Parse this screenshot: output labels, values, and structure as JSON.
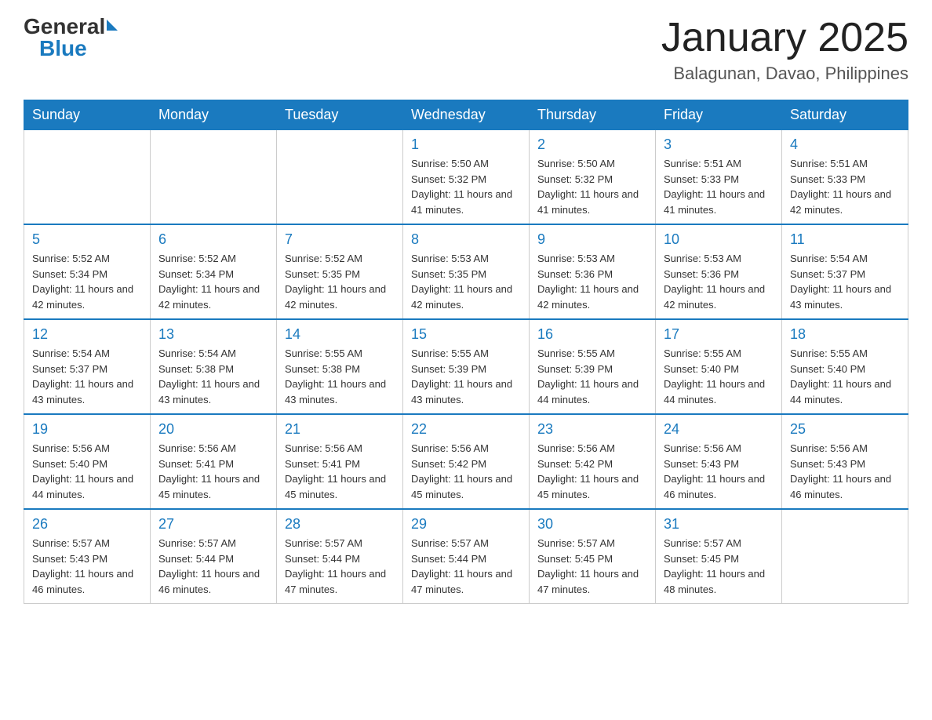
{
  "header": {
    "logo_general": "General",
    "logo_blue": "Blue",
    "month_title": "January 2025",
    "location": "Balagunan, Davao, Philippines"
  },
  "weekdays": [
    "Sunday",
    "Monday",
    "Tuesday",
    "Wednesday",
    "Thursday",
    "Friday",
    "Saturday"
  ],
  "weeks": [
    [
      {
        "day": "",
        "sunrise": "",
        "sunset": "",
        "daylight": ""
      },
      {
        "day": "",
        "sunrise": "",
        "sunset": "",
        "daylight": ""
      },
      {
        "day": "",
        "sunrise": "",
        "sunset": "",
        "daylight": ""
      },
      {
        "day": "1",
        "sunrise": "5:50 AM",
        "sunset": "5:32 PM",
        "daylight": "11 hours and 41 minutes."
      },
      {
        "day": "2",
        "sunrise": "5:50 AM",
        "sunset": "5:32 PM",
        "daylight": "11 hours and 41 minutes."
      },
      {
        "day": "3",
        "sunrise": "5:51 AM",
        "sunset": "5:33 PM",
        "daylight": "11 hours and 41 minutes."
      },
      {
        "day": "4",
        "sunrise": "5:51 AM",
        "sunset": "5:33 PM",
        "daylight": "11 hours and 42 minutes."
      }
    ],
    [
      {
        "day": "5",
        "sunrise": "5:52 AM",
        "sunset": "5:34 PM",
        "daylight": "11 hours and 42 minutes."
      },
      {
        "day": "6",
        "sunrise": "5:52 AM",
        "sunset": "5:34 PM",
        "daylight": "11 hours and 42 minutes."
      },
      {
        "day": "7",
        "sunrise": "5:52 AM",
        "sunset": "5:35 PM",
        "daylight": "11 hours and 42 minutes."
      },
      {
        "day": "8",
        "sunrise": "5:53 AM",
        "sunset": "5:35 PM",
        "daylight": "11 hours and 42 minutes."
      },
      {
        "day": "9",
        "sunrise": "5:53 AM",
        "sunset": "5:36 PM",
        "daylight": "11 hours and 42 minutes."
      },
      {
        "day": "10",
        "sunrise": "5:53 AM",
        "sunset": "5:36 PM",
        "daylight": "11 hours and 42 minutes."
      },
      {
        "day": "11",
        "sunrise": "5:54 AM",
        "sunset": "5:37 PM",
        "daylight": "11 hours and 43 minutes."
      }
    ],
    [
      {
        "day": "12",
        "sunrise": "5:54 AM",
        "sunset": "5:37 PM",
        "daylight": "11 hours and 43 minutes."
      },
      {
        "day": "13",
        "sunrise": "5:54 AM",
        "sunset": "5:38 PM",
        "daylight": "11 hours and 43 minutes."
      },
      {
        "day": "14",
        "sunrise": "5:55 AM",
        "sunset": "5:38 PM",
        "daylight": "11 hours and 43 minutes."
      },
      {
        "day": "15",
        "sunrise": "5:55 AM",
        "sunset": "5:39 PM",
        "daylight": "11 hours and 43 minutes."
      },
      {
        "day": "16",
        "sunrise": "5:55 AM",
        "sunset": "5:39 PM",
        "daylight": "11 hours and 44 minutes."
      },
      {
        "day": "17",
        "sunrise": "5:55 AM",
        "sunset": "5:40 PM",
        "daylight": "11 hours and 44 minutes."
      },
      {
        "day": "18",
        "sunrise": "5:55 AM",
        "sunset": "5:40 PM",
        "daylight": "11 hours and 44 minutes."
      }
    ],
    [
      {
        "day": "19",
        "sunrise": "5:56 AM",
        "sunset": "5:40 PM",
        "daylight": "11 hours and 44 minutes."
      },
      {
        "day": "20",
        "sunrise": "5:56 AM",
        "sunset": "5:41 PM",
        "daylight": "11 hours and 45 minutes."
      },
      {
        "day": "21",
        "sunrise": "5:56 AM",
        "sunset": "5:41 PM",
        "daylight": "11 hours and 45 minutes."
      },
      {
        "day": "22",
        "sunrise": "5:56 AM",
        "sunset": "5:42 PM",
        "daylight": "11 hours and 45 minutes."
      },
      {
        "day": "23",
        "sunrise": "5:56 AM",
        "sunset": "5:42 PM",
        "daylight": "11 hours and 45 minutes."
      },
      {
        "day": "24",
        "sunrise": "5:56 AM",
        "sunset": "5:43 PM",
        "daylight": "11 hours and 46 minutes."
      },
      {
        "day": "25",
        "sunrise": "5:56 AM",
        "sunset": "5:43 PM",
        "daylight": "11 hours and 46 minutes."
      }
    ],
    [
      {
        "day": "26",
        "sunrise": "5:57 AM",
        "sunset": "5:43 PM",
        "daylight": "11 hours and 46 minutes."
      },
      {
        "day": "27",
        "sunrise": "5:57 AM",
        "sunset": "5:44 PM",
        "daylight": "11 hours and 46 minutes."
      },
      {
        "day": "28",
        "sunrise": "5:57 AM",
        "sunset": "5:44 PM",
        "daylight": "11 hours and 47 minutes."
      },
      {
        "day": "29",
        "sunrise": "5:57 AM",
        "sunset": "5:44 PM",
        "daylight": "11 hours and 47 minutes."
      },
      {
        "day": "30",
        "sunrise": "5:57 AM",
        "sunset": "5:45 PM",
        "daylight": "11 hours and 47 minutes."
      },
      {
        "day": "31",
        "sunrise": "5:57 AM",
        "sunset": "5:45 PM",
        "daylight": "11 hours and 48 minutes."
      },
      {
        "day": "",
        "sunrise": "",
        "sunset": "",
        "daylight": ""
      }
    ]
  ]
}
